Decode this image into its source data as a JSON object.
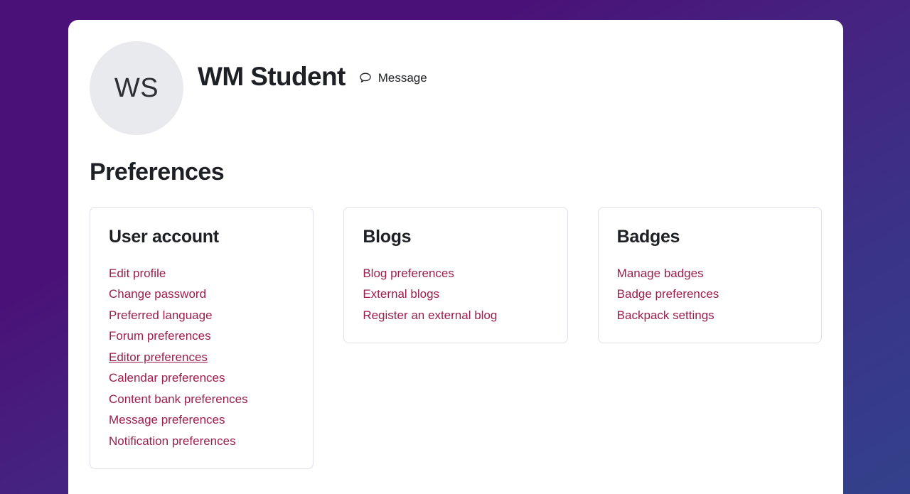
{
  "theme": {
    "background_gradient_from": "#4a1278",
    "background_gradient_to": "#33418b",
    "panel_background": "#ffffff",
    "link_color": "#9c1e4e",
    "card_border_color": "#dee2e6",
    "avatar_background": "#e9eaee",
    "text_color": "#1d2125"
  },
  "user": {
    "initials": "WS",
    "name": "WM Student",
    "message_label": "Message",
    "message_icon": "speech-bubble-icon"
  },
  "page": {
    "title": "Preferences"
  },
  "cards": [
    {
      "title": "User account",
      "links": [
        {
          "label": "Edit profile",
          "active": false
        },
        {
          "label": "Change password",
          "active": false
        },
        {
          "label": "Preferred language",
          "active": false
        },
        {
          "label": "Forum preferences",
          "active": false
        },
        {
          "label": "Editor preferences",
          "active": true
        },
        {
          "label": "Calendar preferences",
          "active": false
        },
        {
          "label": "Content bank preferences",
          "active": false
        },
        {
          "label": "Message preferences",
          "active": false
        },
        {
          "label": "Notification preferences",
          "active": false
        }
      ]
    },
    {
      "title": "Blogs",
      "links": [
        {
          "label": "Blog preferences",
          "active": false
        },
        {
          "label": "External blogs",
          "active": false
        },
        {
          "label": "Register an external blog",
          "active": false
        }
      ]
    },
    {
      "title": "Badges",
      "links": [
        {
          "label": "Manage badges",
          "active": false
        },
        {
          "label": "Badge preferences",
          "active": false
        },
        {
          "label": "Backpack settings",
          "active": false
        }
      ]
    }
  ]
}
